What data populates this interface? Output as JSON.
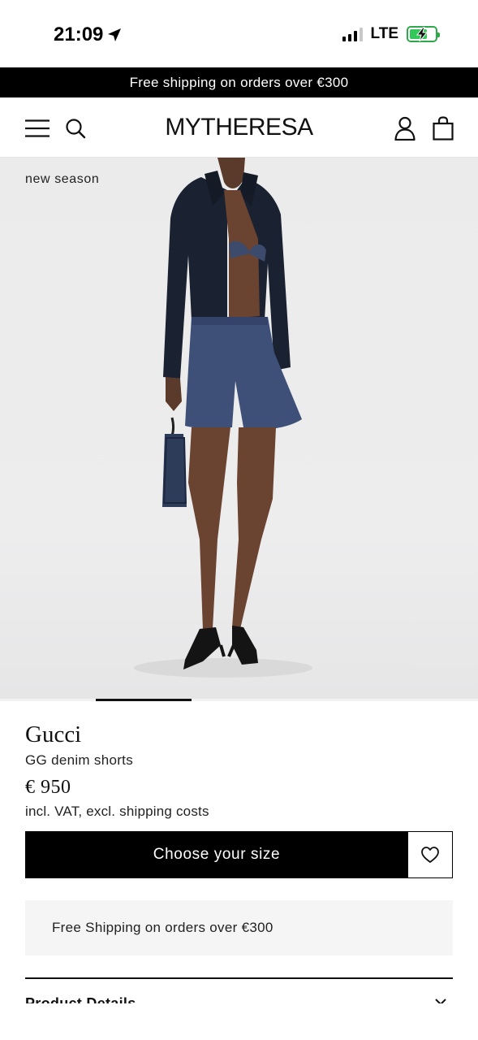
{
  "status_bar": {
    "time": "21:09",
    "network": "LTE",
    "icons": [
      "location-arrow-icon",
      "signal-icon",
      "battery-charging-icon"
    ],
    "battery_color": "#34c759",
    "battery_level": 0.7
  },
  "promo_banner": {
    "text": "Free shipping on orders over €300"
  },
  "header": {
    "logo": "MYTHERESA",
    "icons": [
      "menu-icon",
      "search-icon",
      "account-icon",
      "shopping-bag-icon"
    ]
  },
  "product_image": {
    "label": "new season",
    "active_slide": 2
  },
  "product": {
    "brand": "Gucci",
    "name": "GG denim shorts",
    "price": "€ 950",
    "price_note": "incl. VAT, excl. shipping costs"
  },
  "actions": {
    "size_button_label": "Choose your size",
    "wishlist_icon": "heart-icon"
  },
  "shipping_info": {
    "text": "Free Shipping on orders over €300"
  },
  "accordion": {
    "title": "Product Details"
  },
  "colors": {
    "banner_bg": "#000000",
    "accent": "#000000",
    "panel_bg": "#f5f5f5"
  }
}
